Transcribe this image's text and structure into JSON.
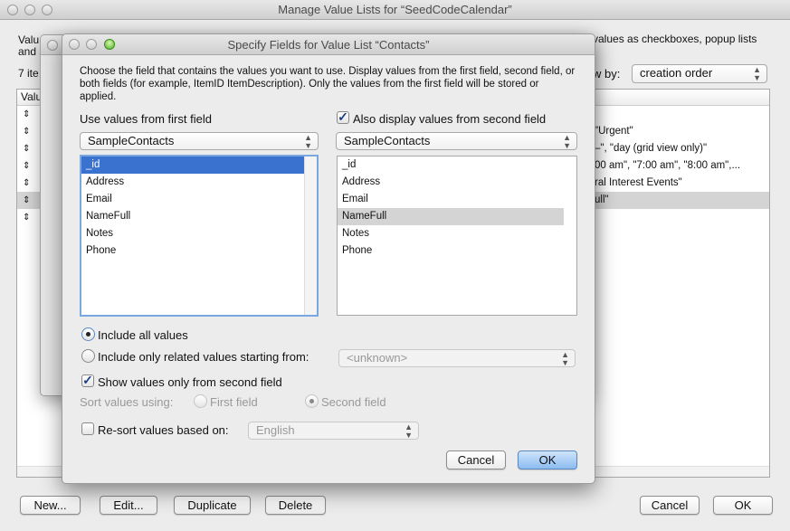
{
  "main_window": {
    "title": "Manage Value Lists for “SeedCodeCalendar”",
    "intro_fragment_1": "Valu",
    "intro_fragment_2": "and s",
    "intro_fragment_right": "values as checkboxes, popup lists",
    "count_fragment": "7 ite",
    "view_by_label_fragment": "w by:",
    "view_by_value": "creation order",
    "column_header_fragment": "Valu",
    "row_fragments": [
      "\"Urgent\"",
      "–\", \"day (grid view only)\"",
      "00 am\", \"7:00 am\", \"8:00 am\",...",
      "ral Interest Events\"",
      "ull\""
    ],
    "buttons": {
      "new": "New...",
      "edit": "Edit...",
      "duplicate": "Duplicate",
      "delete": "Delete",
      "cancel": "Cancel",
      "ok": "OK"
    }
  },
  "dialog": {
    "title": "Specify Fields for Value List “Contacts”",
    "instructions": "Choose the field that contains the values you want to use.  Display values from the first field, second field, or both fields (for example, ItemID ItemDescription). Only the values from the first field will be stored or applied.",
    "first_field_label": "Use values from first field",
    "first_table": "SampleContacts",
    "first_fields": [
      "_id",
      "Address",
      "Email",
      "NameFull",
      "Notes",
      "Phone"
    ],
    "first_selected": "_id",
    "second_field_label": "Also display values from second field",
    "second_checked": true,
    "second_table": "SampleContacts",
    "second_fields": [
      "_id",
      "Address",
      "Email",
      "NameFull",
      "Notes",
      "Phone"
    ],
    "second_selected": "NameFull",
    "include_all": "Include all values",
    "include_related": "Include only related values starting from:",
    "related_value": "<unknown>",
    "show_second_only": "Show values only from second field",
    "show_second_only_checked": true,
    "sort_label": "Sort values using:",
    "sort_first": "First field",
    "sort_second": "Second field",
    "resort_label": "Re-sort values based on:",
    "resort_checked": false,
    "resort_value": "English",
    "cancel": "Cancel",
    "ok": "OK"
  }
}
